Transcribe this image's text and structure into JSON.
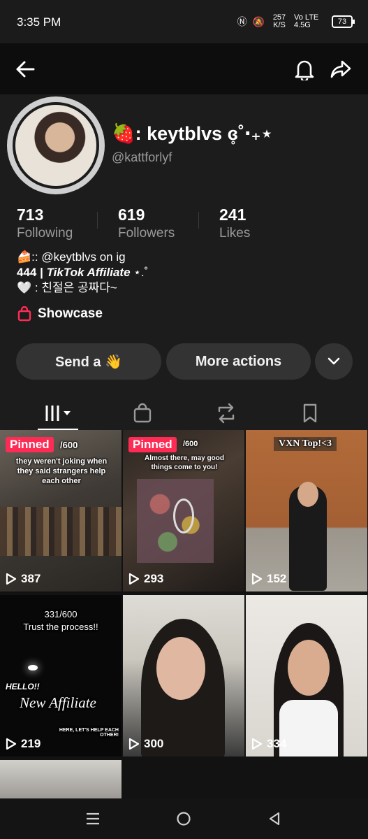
{
  "status_bar": {
    "time": "3:35 PM",
    "net_speed": "257 K/S",
    "network": "Vo LTE 4.5G",
    "battery": "73"
  },
  "nav": {
    "back_icon": "arrow-left-icon",
    "notification_icon": "bell-icon",
    "share_icon": "share-icon"
  },
  "profile": {
    "display_name": "🍓: keytblvs ɞ̥˚‧₊⋆",
    "username": "@kattforlyf",
    "stats": [
      {
        "value": "713",
        "label": "Following"
      },
      {
        "value": "619",
        "label": "Followers"
      },
      {
        "value": "241",
        "label": "Likes"
      }
    ],
    "bio": {
      "line1": "🍰:: @keytblvs on ig",
      "line2_prefix": "444 | ",
      "line2_emph": "TikTok Affiliate",
      "line2_suffix": " ⋆.˚",
      "line3": "🤍 : 친절은 공짜다~"
    },
    "showcase_label": "Showcase",
    "buttons": {
      "send": "Send a 👋",
      "more": "More actions"
    }
  },
  "tabs": [
    "videos",
    "shop",
    "reposts",
    "saved"
  ],
  "videos": [
    {
      "pinned": "Pinned",
      "counter": "/600",
      "caption": "they weren't joking when they said strangers help each other",
      "views": "387"
    },
    {
      "pinned": "Pinned",
      "counter": "/600",
      "caption": "Almost there, may good things come to you!",
      "views": "293"
    },
    {
      "caption": "VXN Top!<3",
      "views": "152"
    },
    {
      "counter": "331/600",
      "caption": "Trust the process!!",
      "sub1": "HELLO!!",
      "sub2": "New Affiliate",
      "sub3": "HERE, LET'S HELP EACH OTHER!",
      "views": "219"
    },
    {
      "views": "300"
    },
    {
      "views": "334"
    }
  ],
  "colors": {
    "accent": "#fe2c55",
    "background": "#121212",
    "pill": "#333333"
  }
}
